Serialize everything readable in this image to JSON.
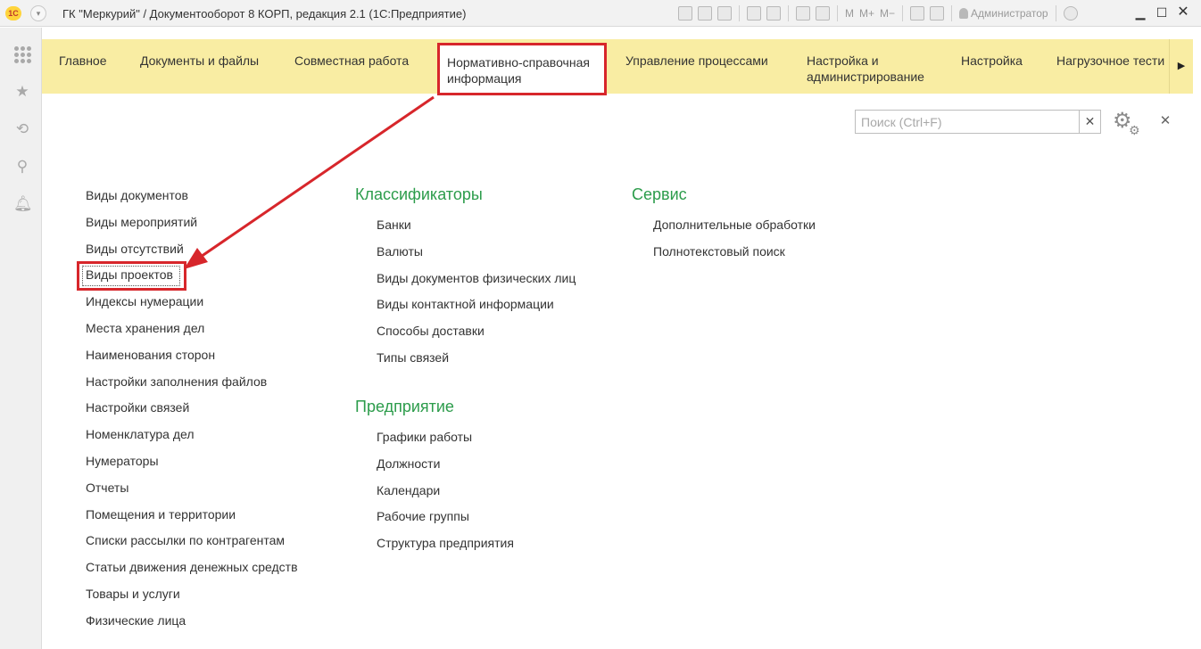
{
  "window": {
    "title": "ГК \"Меркурий\" / Документооборот 8 КОРП, редакция 2.1  (1С:Предприятие)",
    "logo_text": "1С",
    "user": "Администратор",
    "toolbar_text": [
      "М",
      "М+",
      "М−"
    ]
  },
  "sections": [
    {
      "label": "Главное"
    },
    {
      "label": "Документы и файлы"
    },
    {
      "label": "Совместная работа"
    },
    {
      "label": "Нормативно-справочная информация",
      "active": true
    },
    {
      "label": "Управление процессами"
    },
    {
      "label": "Настройка и администрирование"
    },
    {
      "label": "Настройка"
    },
    {
      "label": "Нагрузочное тести"
    }
  ],
  "search": {
    "placeholder": "Поиск (Ctrl+F)",
    "value": ""
  },
  "left_column": [
    "Виды документов",
    "Виды мероприятий",
    "Виды отсутствий",
    "Виды проектов",
    "Индексы нумерации",
    "Места хранения дел",
    "Наименования сторон",
    "Настройки заполнения файлов",
    "Настройки связей",
    "Номенклатура дел",
    "Нумераторы",
    "Отчеты",
    "Помещения и территории",
    "Списки рассылки по контрагентам",
    "Статьи движения денежных средств",
    "Товары и услуги",
    "Физические лица"
  ],
  "groups": {
    "classifiers": {
      "title": "Классификаторы",
      "items": [
        "Банки",
        "Валюты",
        "Виды документов физических лиц",
        "Виды контактной информации",
        "Способы доставки",
        "Типы связей"
      ]
    },
    "enterprise": {
      "title": "Предприятие",
      "items": [
        "Графики работы",
        "Должности",
        "Календари",
        "Рабочие группы",
        "Структура предприятия"
      ]
    },
    "service": {
      "title": "Сервис",
      "items": [
        "Дополнительные обработки",
        "Полнотекстовый поиск"
      ]
    }
  },
  "colors": {
    "section_bar": "#f9eda3",
    "highlight": "#d7262b",
    "group_title": "#2c9c4b"
  },
  "icons": [
    "apps-grid-icon",
    "favorites-star-icon",
    "history-icon",
    "search-icon",
    "bell-icon",
    "gear-icon",
    "close-icon"
  ]
}
